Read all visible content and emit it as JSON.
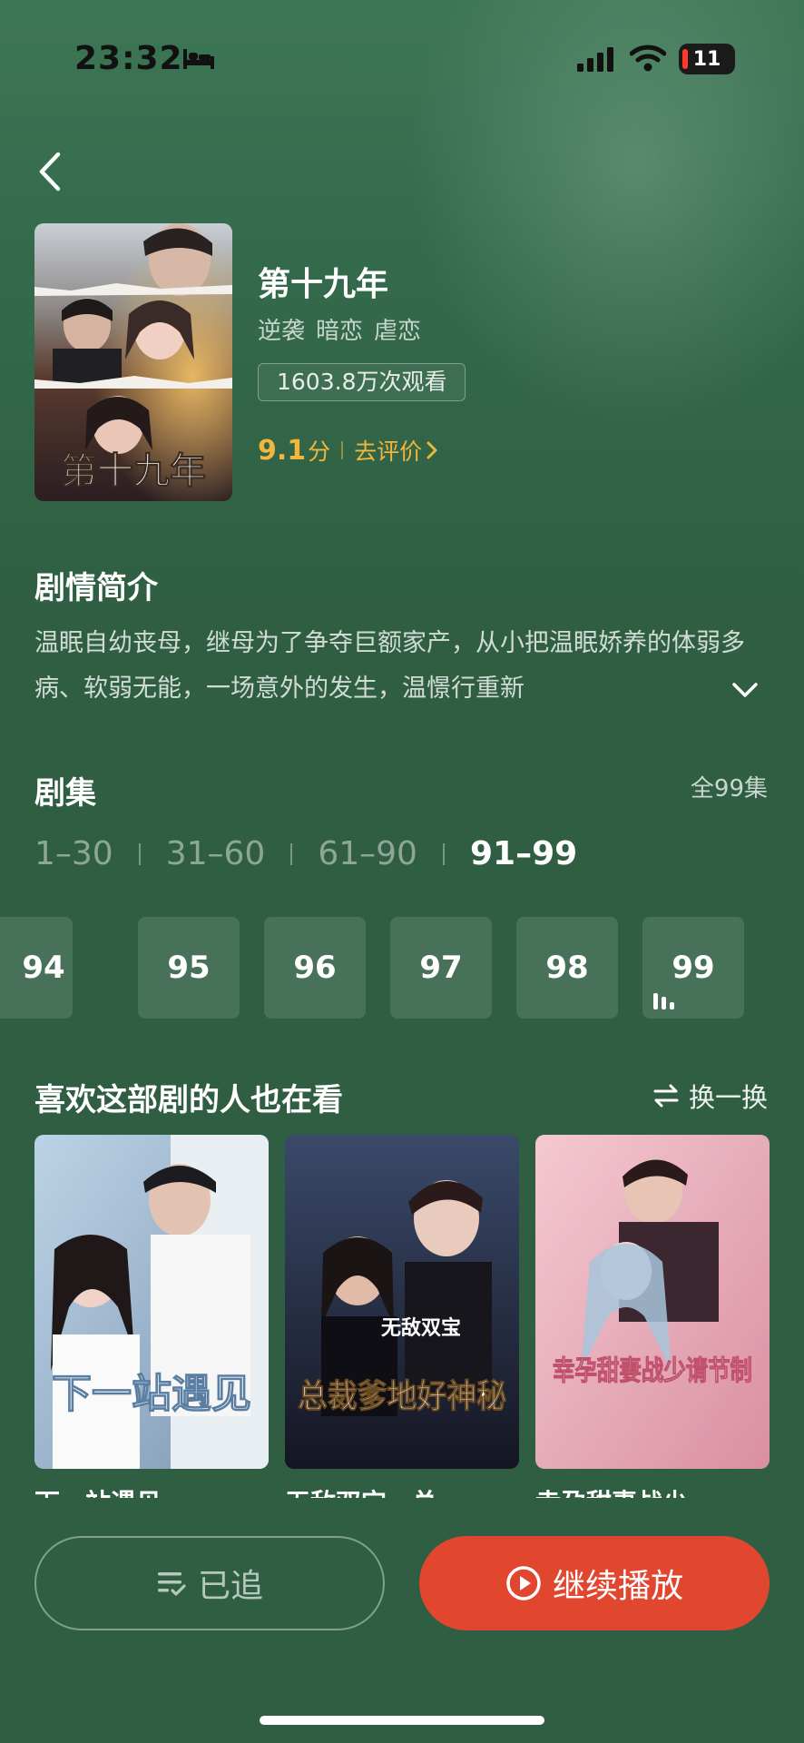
{
  "status_bar": {
    "time": "23:32",
    "battery": "11"
  },
  "show": {
    "title": "第十九年",
    "poster_text": "第十九年",
    "tags": [
      "逆袭",
      "暗恋",
      "虐恋"
    ],
    "views": "1603.8万次观看",
    "rating": "9.1",
    "rating_unit": "分",
    "rate_link": "去评价"
  },
  "synopsis": {
    "title": "剧情简介",
    "text": "温眠自幼丧母，继母为了争夺巨额家产，从小把温眠娇养的体弱多病、软弱无能，一场意外的发生，温憬行重新"
  },
  "episodes": {
    "title": "剧集",
    "total": "全99集",
    "ranges": [
      "1–30",
      "31–60",
      "61–90",
      "91–99"
    ],
    "active_range": 3,
    "items": [
      "94",
      "95",
      "96",
      "97",
      "98",
      "99"
    ],
    "playing": "99"
  },
  "recommend": {
    "title": "喜欢这部剧的人也在看",
    "shuffle_label": "换一换",
    "items": [
      {
        "title": "下一站遇见",
        "poster_text": "下一站遇见"
      },
      {
        "title": "无敌双宝，总…",
        "poster_text": "总裁爹地好神秘",
        "poster_sub": "无敌双宝"
      },
      {
        "title": "幸孕甜妻战少…",
        "poster_text": "幸孕甜妻战少请节制"
      }
    ]
  },
  "actions": {
    "follow_label": "已追",
    "play_label": "继续播放"
  },
  "colors": {
    "accent": "#e1472f",
    "rating": "#f2b63c",
    "background": "#2f5e43"
  }
}
